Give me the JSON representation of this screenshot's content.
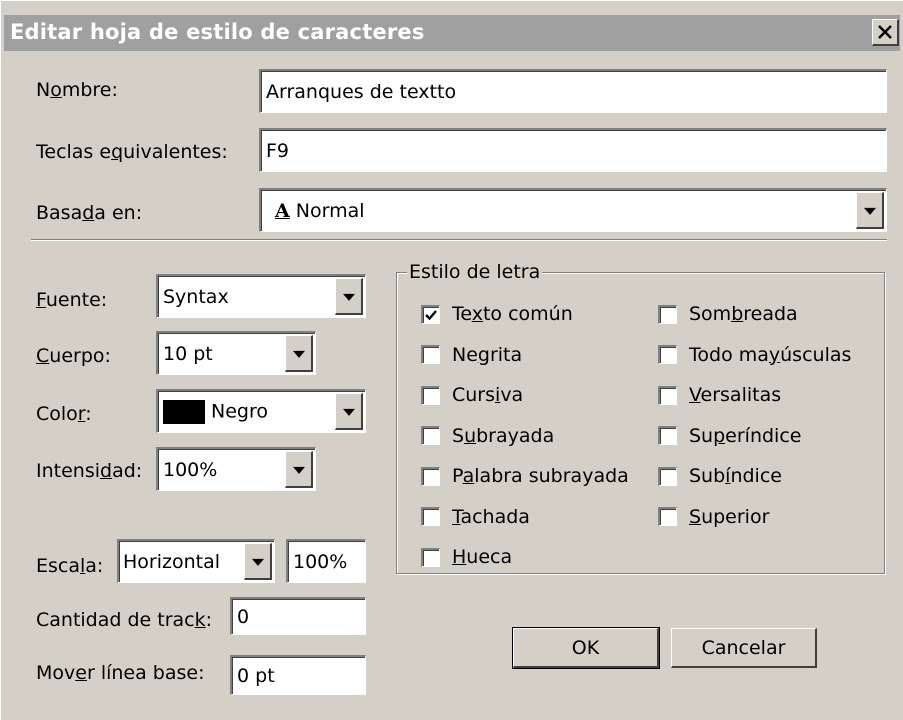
{
  "dialog": {
    "title": "Editar hoja de estilo de caracteres"
  },
  "fields": {
    "name_label_pre": "N",
    "name_label_u": "o",
    "name_label_post": "mbre:",
    "name_value": "Arranques de textto",
    "keys_label_pre": "Teclas e",
    "keys_label_u": "q",
    "keys_label_post": "uivalentes:",
    "keys_value": "F9",
    "based_label_pre": "Basa",
    "based_label_u": "d",
    "based_label_post": "a en:",
    "based_icon": "A",
    "based_value": "Normal"
  },
  "font": {
    "font_label_u": "F",
    "font_label_post": "uente:",
    "font_value": "Syntax",
    "size_label_u": "C",
    "size_label_post": "uerpo:",
    "size_value": "10 pt",
    "color_label_pre": "Colo",
    "color_label_u": "r",
    "color_label_post": ":",
    "color_value": "Negro",
    "color_swatch": "#000000",
    "shade_label_pre": "Intensi",
    "shade_label_u": "d",
    "shade_label_post": "ad:",
    "shade_value": "100%",
    "scale_label_pre": "Esca",
    "scale_label_u": "l",
    "scale_label_post": "a:",
    "scale_mode": "Horizontal",
    "scale_value": "100%",
    "track_label_pre": "Cantidad de trac",
    "track_label_u": "k",
    "track_label_post": ":",
    "track_value": "0",
    "baseline_label_pre": "Mov",
    "baseline_label_u": "e",
    "baseline_label_post": "r línea base:",
    "baseline_value": "0 pt"
  },
  "style_group": {
    "legend": "Estilo de letra",
    "left": [
      {
        "pre": "Te",
        "u": "x",
        "post": "to común",
        "checked": true
      },
      {
        "pre": "Ne",
        "u": "g",
        "post": "rita",
        "checked": false
      },
      {
        "pre": "Curs",
        "u": "i",
        "post": "va",
        "checked": false
      },
      {
        "pre": "S",
        "u": "u",
        "post": "brayada",
        "checked": false
      },
      {
        "pre": "P",
        "u": "a",
        "post": "labra subrayada",
        "checked": false
      },
      {
        "pre": "",
        "u": "T",
        "post": "achada",
        "checked": false
      },
      {
        "pre": "",
        "u": "H",
        "post": "ueca",
        "checked": false
      }
    ],
    "right": [
      {
        "pre": "Som",
        "u": "b",
        "post": "reada",
        "checked": false
      },
      {
        "pre": "Todo ma",
        "u": "y",
        "post": "úsculas",
        "checked": false
      },
      {
        "pre": "",
        "u": "V",
        "post": "ersalitas",
        "checked": false
      },
      {
        "pre": "Su",
        "u": "p",
        "post": "eríndice",
        "checked": false
      },
      {
        "pre": "Sub",
        "u": "í",
        "post": "ndice",
        "checked": false
      },
      {
        "pre": "",
        "u": "S",
        "post": "uperior",
        "checked": false
      }
    ]
  },
  "buttons": {
    "ok": "OK",
    "cancel": "Cancelar"
  }
}
